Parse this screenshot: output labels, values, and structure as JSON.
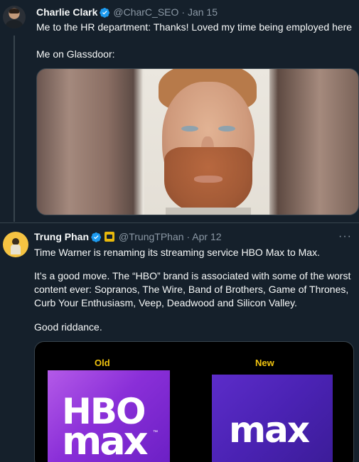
{
  "tweets": [
    {
      "name": "Charlie Clark",
      "handle": "@CharC_SEO",
      "date": "· Jan 15",
      "line1": "Me to the HR department: Thanks! Loved my time being employed here",
      "line2": "Me on Glassdoor:"
    },
    {
      "name": "Trung Phan",
      "handle": "@TrungTPhan",
      "date": "· Apr 12",
      "more": "···",
      "para1": "Time Warner is renaming its streaming service HBO Max to Max.",
      "para2": "It’s a good move. The “HBO” brand is associated with some of the worst\ncontent ever: Sopranos, The Wire, Band of Brothers, Game of Thrones,\nCurb Your Enthusiasm, Veep, Deadwood and Silicon Valley.",
      "para3": "Good riddance.",
      "card": {
        "old_label": "Old",
        "new_label": "New",
        "old_logo_top": "HBO",
        "old_logo_bottom": "max",
        "old_logo_tm": "™",
        "new_logo": "max"
      }
    }
  ],
  "colors": {
    "background": "#15202b",
    "verified": "#1d9bf0",
    "gold": "#e9b90c",
    "secondary_text": "#8b98a5"
  }
}
